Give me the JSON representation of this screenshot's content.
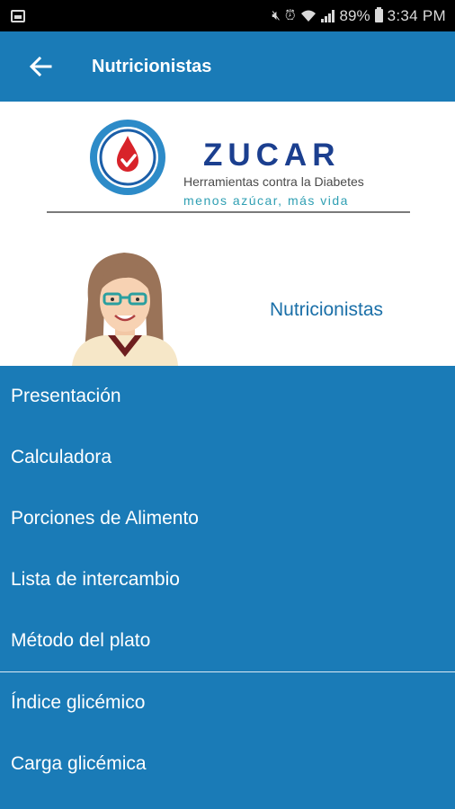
{
  "status_bar": {
    "battery": "89%",
    "time": "3:34 PM",
    "icons": [
      "gallery-icon",
      "mute-icon",
      "alarm-icon",
      "wifi-icon",
      "signal-icon",
      "battery-icon"
    ]
  },
  "app_bar": {
    "title": "Nutricionistas",
    "back_icon": "arrow-left-icon"
  },
  "header": {
    "logo": {
      "name": "ZUCAR",
      "subtitle": "Herramientas contra la Diabetes",
      "tagline": "menos azúcar, más vida"
    },
    "caption": "Nutricionistas"
  },
  "menu": {
    "group1": [
      {
        "label": "Presentación"
      },
      {
        "label": "Calculadora"
      },
      {
        "label": "Porciones de Alimento"
      },
      {
        "label": "Lista de intercambio"
      },
      {
        "label": "Método del plato"
      }
    ],
    "group2": [
      {
        "label": "Índice glicémico"
      },
      {
        "label": "Carga glicémica"
      }
    ]
  },
  "colors": {
    "primary": "#1a7bb7",
    "logo_navy": "#1b3f8f",
    "logo_teal": "#2f9fb3",
    "drop_red": "#d8232a"
  }
}
